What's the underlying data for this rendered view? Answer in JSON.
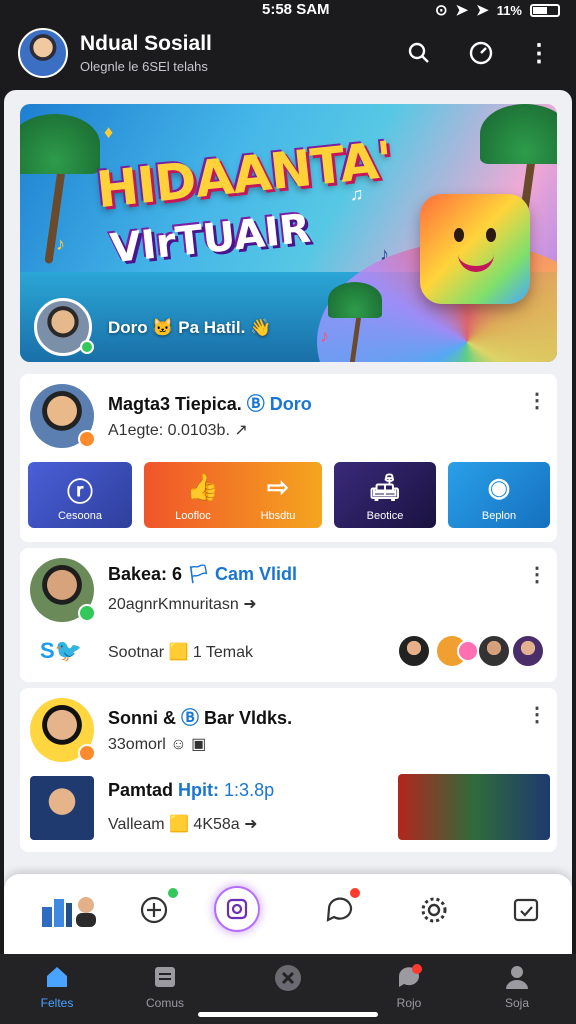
{
  "status": {
    "time": "5:58 SAM",
    "battery_text": "11%"
  },
  "header": {
    "title": "Ndual Sosiall",
    "subtitle": "Olegnle le 6SEl telahs"
  },
  "hero": {
    "headline_line1": "HIDAANTA'",
    "headline_line2": "VIrTUAIR",
    "caption": "Doro 🐱 Pa Hatil. 👋"
  },
  "cards": [
    {
      "name": "Magta3 Tiepica.",
      "tag": "Doro",
      "sub": "A1egte: 0.0103b.",
      "tiles": [
        {
          "icon": "ⓡ",
          "label": "Cesoona",
          "color": "#3a4fb8"
        },
        {
          "icon": "👍",
          "label": "Loofloc",
          "color": "#f07a2a"
        },
        {
          "icon": "⇨",
          "label": "Hbsdtu",
          "color": "#f5a51f"
        },
        {
          "icon": "🛋",
          "label": "Beotice",
          "color": "#2a1e5a"
        },
        {
          "icon": "◉",
          "label": "Beplon",
          "color": "#1d86d1"
        }
      ]
    },
    {
      "name": "Bakea: 6",
      "tag": "Cam Vlidl",
      "sub": "20agnrKmnuritasn",
      "row2": "Sootnar 🟨 1 Temak",
      "twitter": "S🐦"
    },
    {
      "name": "Sonni &",
      "tag": "Bar Vldks.",
      "sub": "33omorl",
      "row2_title": "Pamtad",
      "row2_tag": "Hpit:",
      "row2_extra": "1:3.8p",
      "row2": "Valleam 🟨 4K58a"
    }
  ],
  "nav": {
    "items": [
      {
        "label": "Feltes",
        "icon": "house-icon"
      },
      {
        "label": "Comus",
        "icon": "list-icon"
      },
      {
        "label": "",
        "icon": "tools-icon"
      },
      {
        "label": "Rojo",
        "icon": "chat-icon"
      },
      {
        "label": "Soja",
        "icon": "person-icon"
      }
    ]
  }
}
